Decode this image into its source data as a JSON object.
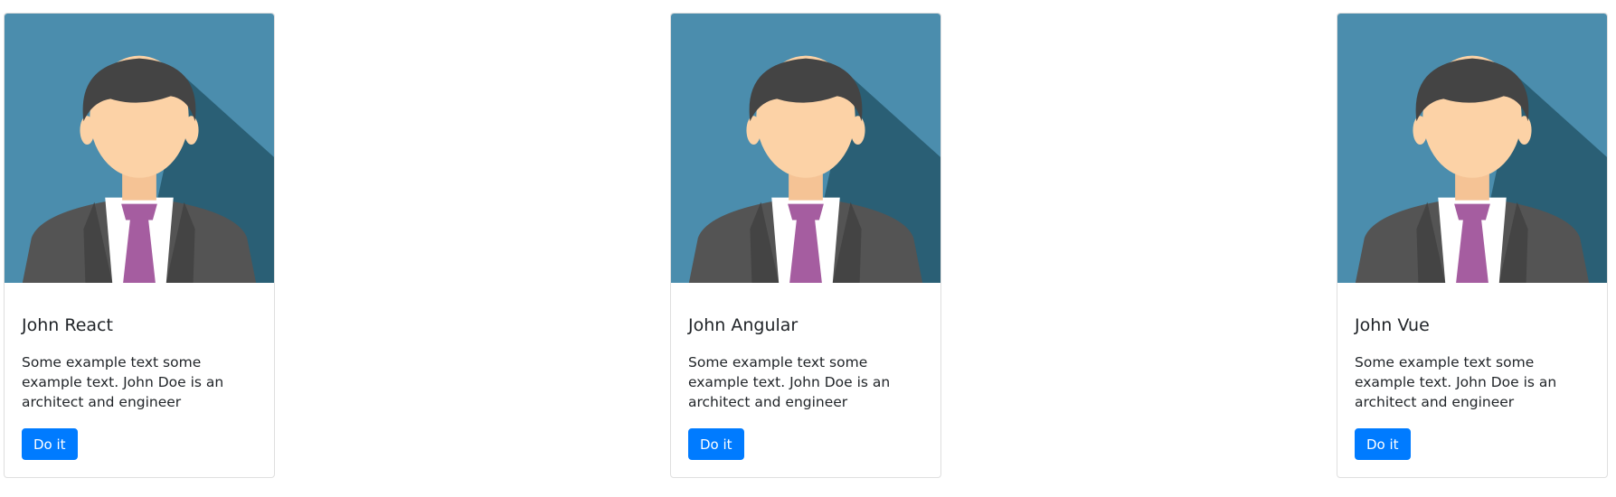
{
  "colors": {
    "button_bg": "#007bff",
    "avatar_bg_light": "#4b8dad",
    "avatar_bg_dark": "#2a5f75",
    "skin": "#fcd2a6",
    "hair": "#444444",
    "suit": "#545454",
    "tie": "#a55da0"
  },
  "cards": [
    {
      "image_icon": "person-avatar-icon",
      "title": "John React",
      "text": "Some example text some example text. John Doe is an architect and engineer",
      "button_label": "Do it"
    },
    {
      "image_icon": "person-avatar-icon",
      "title": "John Angular",
      "text": "Some example text some example text. John Doe is an architect and engineer",
      "button_label": "Do it"
    },
    {
      "image_icon": "person-avatar-icon",
      "title": "John Vue",
      "text": "Some example text some example text. John Doe is an architect and engineer",
      "button_label": "Do it"
    }
  ]
}
